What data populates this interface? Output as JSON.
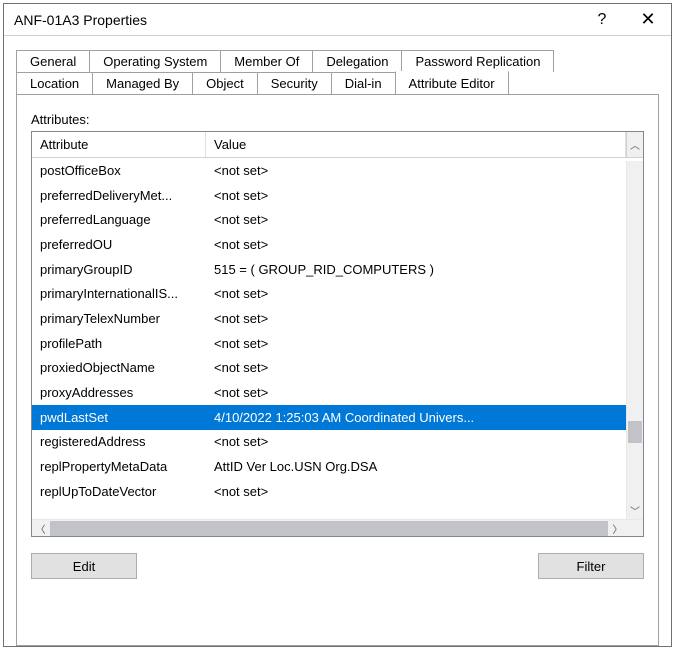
{
  "titlebar": {
    "title": "ANF-01A3 Properties",
    "help": "?",
    "close": "✕"
  },
  "tabs": {
    "row1": [
      "General",
      "Operating System",
      "Member Of",
      "Delegation",
      "Password Replication"
    ],
    "row2": [
      "Location",
      "Managed By",
      "Object",
      "Security",
      "Dial-in",
      "Attribute Editor"
    ]
  },
  "listLabel": "Attributes:",
  "columns": {
    "attr": "Attribute",
    "val": "Value"
  },
  "rows": [
    {
      "attr": "postOfficeBox",
      "val": "<not set>"
    },
    {
      "attr": "preferredDeliveryMet...",
      "val": "<not set>"
    },
    {
      "attr": "preferredLanguage",
      "val": "<not set>"
    },
    {
      "attr": "preferredOU",
      "val": "<not set>"
    },
    {
      "attr": "primaryGroupID",
      "val": "515 = ( GROUP_RID_COMPUTERS )"
    },
    {
      "attr": "primaryInternationalIS...",
      "val": "<not set>"
    },
    {
      "attr": "primaryTelexNumber",
      "val": "<not set>"
    },
    {
      "attr": "profilePath",
      "val": "<not set>"
    },
    {
      "attr": "proxiedObjectName",
      "val": "<not set>"
    },
    {
      "attr": "proxyAddresses",
      "val": "<not set>"
    },
    {
      "attr": "pwdLastSet",
      "val": "4/10/2022 1:25:03 AM Coordinated Univers...",
      "selected": true
    },
    {
      "attr": "registeredAddress",
      "val": "<not set>"
    },
    {
      "attr": "replPropertyMetaData",
      "val": "  AttID   Ver     Loc.USN                   Org.DSA"
    },
    {
      "attr": "replUpToDateVector",
      "val": "<not set>"
    }
  ],
  "buttons": {
    "edit": "Edit",
    "filter": "Filter"
  }
}
